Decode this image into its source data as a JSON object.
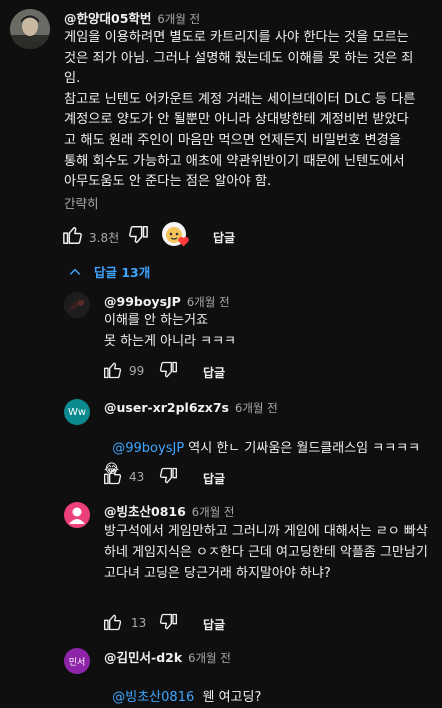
{
  "main_comment": {
    "handle": "@한양대05학번",
    "time": "6개월 전",
    "text": "게임을 이용하려면 별도로 카트리지를 사야 한다는 것을 모르는 것은 죄가 아님. 그러나 설명해 줬는데도 이해를 못 하는 것은 죄임.\n참고로 닌텐도 어카운트 계정 거래는 세이브데이터 DLC 등 다른계정으로 양도가 안 될뿐만 아니라 상대방한테 계정비번 받았다고 해도 원래 주인이 마음만 먹으면 언제든지 비밀번호 변경을 통해 회수도 가능하고 애초에 약관위반이기 때문에 닌텐도에서 아무도움도 안 준다는 점은 알아야 함.",
    "read_less": "간략히",
    "likes": "3.8천",
    "reply_label": "답글"
  },
  "replies_toggle": {
    "label": "답글 13개"
  },
  "replies": [
    {
      "handle": "@99boysJP",
      "time": "6개월 전",
      "text": "이해를 안 하는거죠\n못 하는게 아니라 ㅋㅋㅋ",
      "likes": "99",
      "reply_label": "답글"
    },
    {
      "handle": "@user-xr2pl6zx7s",
      "time": "6개월 전",
      "avatar_text": "Ww",
      "mention": "@99boysJP",
      "text": " 역시 한ㄴ 기싸움은 월드클래스임 ㅋㅋㅋㅋ 😂",
      "likes": "43",
      "reply_label": "답글"
    },
    {
      "handle": "@빙초산0816",
      "time": "6개월 전",
      "text": "방구석에서 게임만하고 그러니까 게임에 대해서는 ㄹㅇ 빠삭하네 게임지식은 ㅇㅈ한다 근데 여고딩한테 악플좀 그만남기고다녀 고딩은 당근거래 하지말아야 하냐?",
      "likes": "13",
      "reply_label": "답글"
    },
    {
      "handle": "@김민서-d2k",
      "time": "6개월 전",
      "avatar_text": "민서",
      "mention": "@빙초산0816",
      "text": "  웬 여고딩?"
    }
  ],
  "colors": {
    "background": "#0f0f0f",
    "mention": "#3ea6ff",
    "toggle": "#3ea6ff",
    "avatar_ww": "#0b8a8f",
    "avatar_pink": "#ec407a",
    "avatar_minseo": "#8e24aa"
  },
  "icons": [
    "thumbs-up-icon",
    "thumbs-down-icon",
    "chevron-up-icon",
    "creator-heart-icon",
    "person-icon"
  ]
}
